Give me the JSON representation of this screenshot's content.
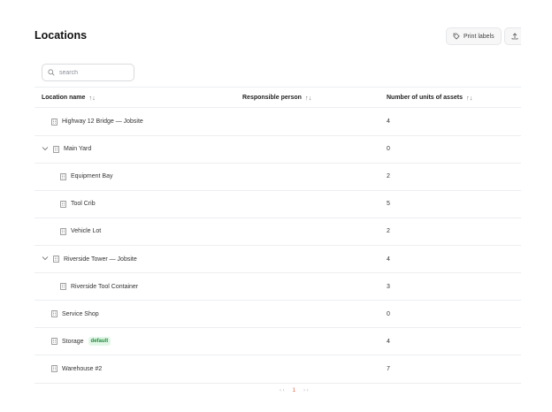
{
  "page": {
    "title": "Locations"
  },
  "toolbar": {
    "print_label": "Print labels",
    "export_label": "I"
  },
  "search": {
    "placeholder": "search",
    "value": ""
  },
  "table": {
    "columns": [
      {
        "label": "Location name",
        "sort": "↑↓"
      },
      {
        "label": "Responsible person",
        "sort": "↑↓"
      },
      {
        "label": "Number of units of assets",
        "sort": "↑↓"
      }
    ],
    "rows": [
      {
        "name": "Highway 12 Bridge — Jobsite",
        "units": "4",
        "level": 0,
        "expandable": false
      },
      {
        "name": "Main Yard",
        "units": "0",
        "level": 0,
        "expandable": true
      },
      {
        "name": "Equipment Bay",
        "units": "2",
        "level": 1,
        "expandable": false
      },
      {
        "name": "Tool Crib",
        "units": "5",
        "level": 1,
        "expandable": false
      },
      {
        "name": "Vehicle Lot",
        "units": "2",
        "level": 1,
        "expandable": false
      },
      {
        "name": "Riverside Tower — Jobsite",
        "units": "4",
        "level": 0,
        "expandable": true
      },
      {
        "name": "Riverside Tool Container",
        "units": "3",
        "level": 1,
        "expandable": false
      },
      {
        "name": "Service Shop",
        "units": "0",
        "level": 0,
        "expandable": false
      },
      {
        "name": "Storage",
        "units": "4",
        "level": 0,
        "expandable": false,
        "badge": "default"
      },
      {
        "name": "Warehouse #2",
        "units": "7",
        "level": 0,
        "expandable": false
      }
    ]
  },
  "pagination": {
    "prev_glyphs": "‹ ‹",
    "current": "1",
    "next_glyphs": "› ›"
  },
  "colors": {
    "accent": "#e4573c",
    "badge_bg": "#e3f7e8",
    "badge_text": "#1f8a3a",
    "divider": "#eceef1"
  },
  "icons": {
    "search": "search-icon",
    "print": "tag-icon",
    "export": "upload-icon",
    "location": "building-icon",
    "expand": "chevron-down-icon"
  }
}
